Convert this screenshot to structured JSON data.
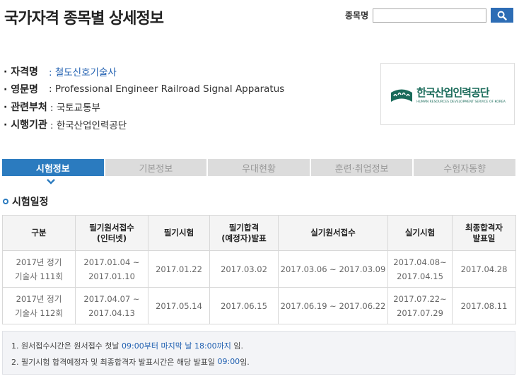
{
  "header": {
    "title": "국가자격 종목별 상세정보",
    "search_label": "종목명",
    "search_value": ""
  },
  "info": {
    "items": [
      {
        "key": "· 자격명",
        "value": ": 철도신호기술사"
      },
      {
        "key": "· 영문명",
        "value": ": Professional Engineer Railroad Signal Apparatus"
      },
      {
        "key": "· 관련부처",
        "value": ": 국토교통부"
      },
      {
        "key": "· 시행기관",
        "value": ": 한국산업인력공단"
      }
    ]
  },
  "logo": {
    "name_kr": "한국산업인력공단",
    "name_en": "HUMAN RESOURCES DEVELOPMENT SERVICE OF KOREA"
  },
  "tabs": [
    "시험정보",
    "기본정보",
    "우대현황",
    "훈련·취업정보",
    "수험자동향"
  ],
  "section": {
    "title": "시험일정"
  },
  "table": {
    "headers": [
      [
        "구분"
      ],
      [
        "필기원서접수",
        "(인터넷)"
      ],
      [
        "필기시험"
      ],
      [
        "필기합격",
        "(예정자)발표"
      ],
      [
        "실기원서접수"
      ],
      [
        "실기시험"
      ],
      [
        "최종합격자",
        "발표일"
      ]
    ],
    "rows": [
      [
        [
          "2017년 정기",
          "기술사 111회"
        ],
        [
          "2017.01.04 ~",
          "2017.01.10"
        ],
        [
          "2017.01.22"
        ],
        [
          "2017.03.02"
        ],
        [
          "2017.03.06 ~ 2017.03.09"
        ],
        [
          "2017.04.08~",
          "2017.04.15"
        ],
        [
          "2017.04.28"
        ]
      ],
      [
        [
          "2017년 정기",
          "기술사 112회"
        ],
        [
          "2017.04.07 ~",
          "2017.04.13"
        ],
        [
          "2017.05.14"
        ],
        [
          "2017.06.15"
        ],
        [
          "2017.06.19 ~ 2017.06.22"
        ],
        [
          "2017.07.22~",
          "2017.07.29"
        ],
        [
          "2017.08.11"
        ]
      ]
    ]
  },
  "notes": {
    "n1_prefix": "1. 원서접수시간은 원서접수 첫날 ",
    "n1_hl": "09:00부터 마지막 날 18:00까지",
    "n1_suffix": " 임.",
    "n2_prefix": "2. 필기시험 합격예정자 및 최종합격자 발표시간은 해당 발표일 ",
    "n2_hl": "09:00",
    "n2_suffix": "임."
  },
  "colors": {
    "accent": "#2b7bbf",
    "search_button": "#2d6db5",
    "link": "#1f5fb0",
    "logo_green": "#1a6b5a",
    "tab_inactive": "#dcdcdc"
  }
}
